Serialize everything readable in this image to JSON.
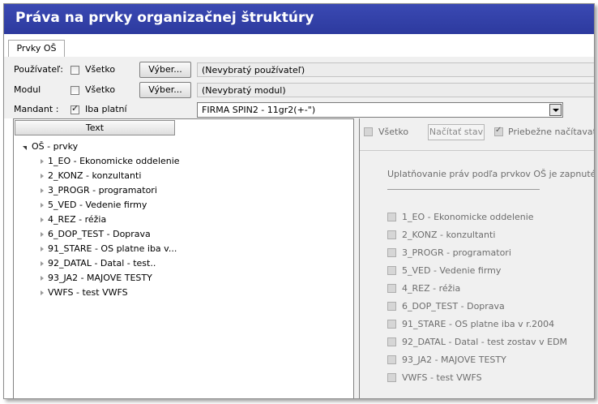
{
  "window": {
    "title": "Práva na prvky organizačnej štruktúry"
  },
  "tabs": [
    {
      "label": "Prvky OŠ"
    }
  ],
  "filters": {
    "user": {
      "label": "Používateľ:",
      "check_label": "Všetko",
      "checked": false,
      "button": "Výber...",
      "value": "(Nevybratý používateľ)"
    },
    "module": {
      "label": "Modul",
      "check_label": "Všetko",
      "checked": false,
      "button": "Výber...",
      "value": "(Nevybratý modul)"
    },
    "mandant": {
      "label": "Mandant :",
      "check_label": "Iba platní",
      "checked": true,
      "value": "FIRMA SPIN2 - 11gr2(+-\")"
    }
  },
  "tree": {
    "column_header": "Text",
    "root": "OŠ - prvky",
    "items": [
      "1_EO - Ekonomicke oddelenie",
      "2_KONZ - konzultanti",
      "3_PROGR - programatori",
      "5_VED - Vedenie firmy",
      "4_REZ - réžia",
      "6_DOP_TEST - Doprava",
      "91_STARE - OS platne iba v...",
      "92_DATAL - Datal - test..",
      "93_JA2 - MAJOVE TESTY",
      "VWFS - test VWFS"
    ]
  },
  "right": {
    "all_label": "Všetko",
    "load_button": "Načítať stav",
    "continuous_label": "Priebežne načítavať",
    "info": "Uplatňovanie práv podľa prvkov OŠ je zapnuté.",
    "items": [
      "1_EO - Ekonomicke oddelenie",
      "2_KONZ - konzultanti",
      "3_PROGR - programatori",
      "5_VED - Vedenie firmy",
      "4_REZ - réžia",
      "6_DOP_TEST - Doprava",
      "91_STARE - OS platne iba v r.2004",
      "92_DATAL - Datal - test zostav v EDM",
      "93_JA2 - MAJOVE TESTY",
      "VWFS - test VWFS"
    ]
  },
  "colors": {
    "title_bar": "#3340a6",
    "title_text": "#ffffff",
    "panel_bg": "#f0f0f0"
  }
}
